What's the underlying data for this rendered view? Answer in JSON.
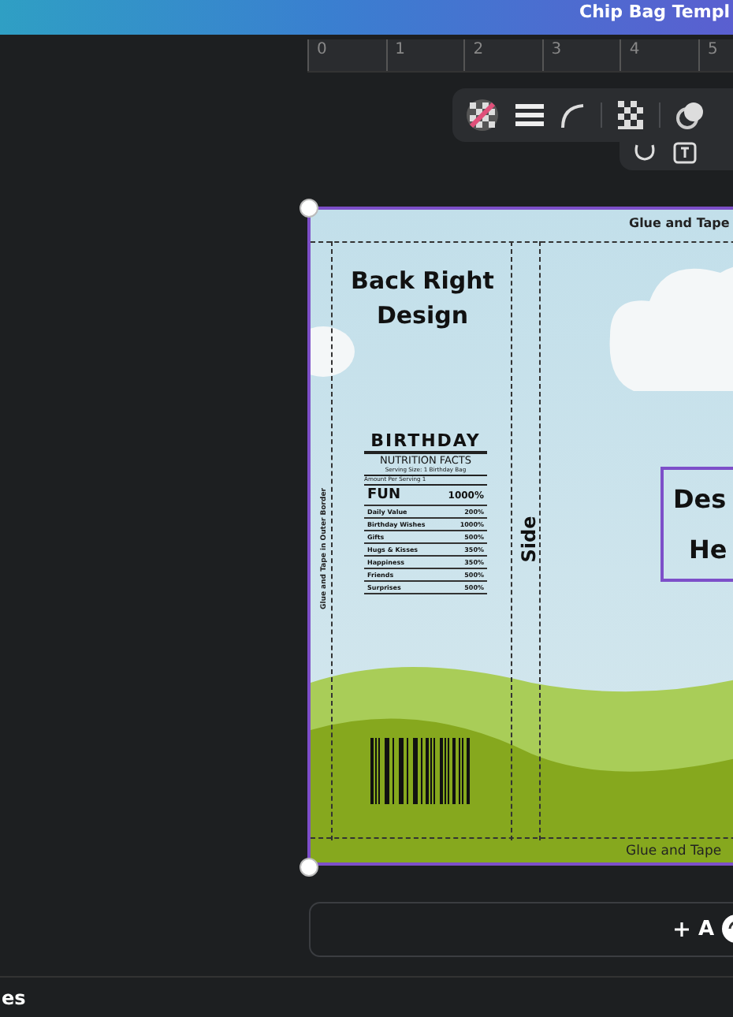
{
  "header": {
    "title": "Chip Bag Templ"
  },
  "ruler": {
    "ticks": [
      "0",
      "1",
      "2",
      "3",
      "4",
      "5"
    ]
  },
  "design": {
    "selected": true,
    "top_flap": "Glue and Tape",
    "bottom_flap": "Glue and Tape",
    "side_flap": "Glue and Tape in Outer Border",
    "back_title": "Back Right Design",
    "nutrition": {
      "heading": "BIRTHDAY",
      "subheading": "NUTRITION FACTS",
      "serving": "Serving Size: 1 Birthday Bag",
      "amount": "Amount Per Serving 1",
      "main": {
        "label": "FUN",
        "value": "1000%"
      },
      "rows": [
        {
          "label": "Daily Value",
          "value": "200%"
        },
        {
          "label": "Birthday Wishes",
          "value": "1000%"
        },
        {
          "label": "Gifts",
          "value": "500%"
        },
        {
          "label": "Hugs & Kisses",
          "value": "350%"
        },
        {
          "label": "Happiness",
          "value": "350%"
        },
        {
          "label": "Friends",
          "value": "500%"
        },
        {
          "label": "Surprises",
          "value": "500%"
        }
      ]
    },
    "side_label": "Side",
    "front_title": [
      "Des",
      "He"
    ]
  },
  "add_button": {
    "label": "A"
  },
  "footer": {
    "label": "es"
  }
}
